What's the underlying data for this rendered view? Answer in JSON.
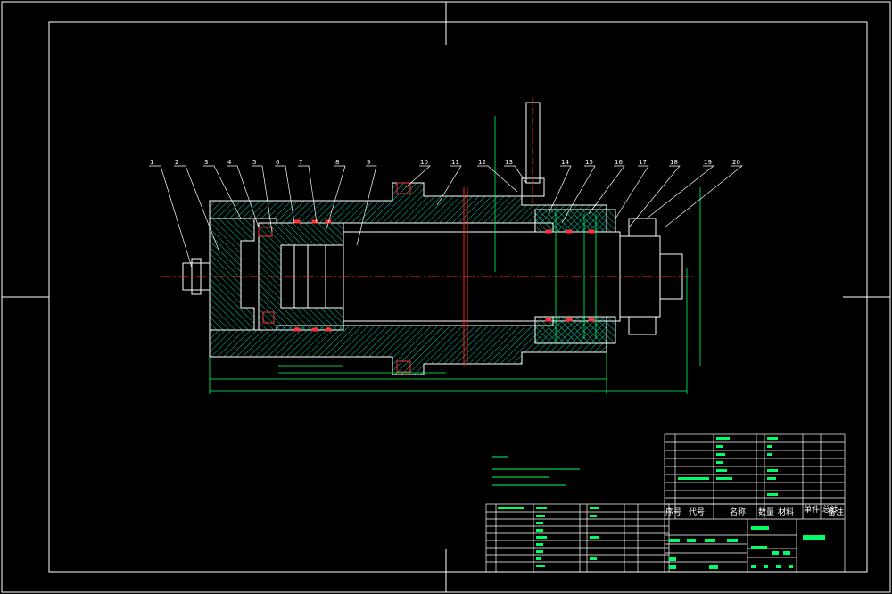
{
  "balloons": [
    "1",
    "2",
    "3",
    "4",
    "5",
    "6",
    "7",
    "8",
    "9",
    "10",
    "11",
    "12",
    "13",
    "14",
    "15",
    "16",
    "17",
    "18",
    "19",
    "20"
  ],
  "title_block": {
    "header_cells": [
      "序号",
      "代号",
      "名称",
      "数量",
      "材料",
      "单件 总计",
      "备注"
    ],
    "subtitle": "重量 比例",
    "drawing_name": "液压缸"
  },
  "colors": {
    "background": "#000000",
    "outline": "#ffffff",
    "dimension": "#00ff66",
    "hatch": "#00ffcc",
    "centerline": "#ff2222",
    "leader": "#ffffff",
    "seal": "#ff3333",
    "yellow_text": "#ffff00"
  }
}
